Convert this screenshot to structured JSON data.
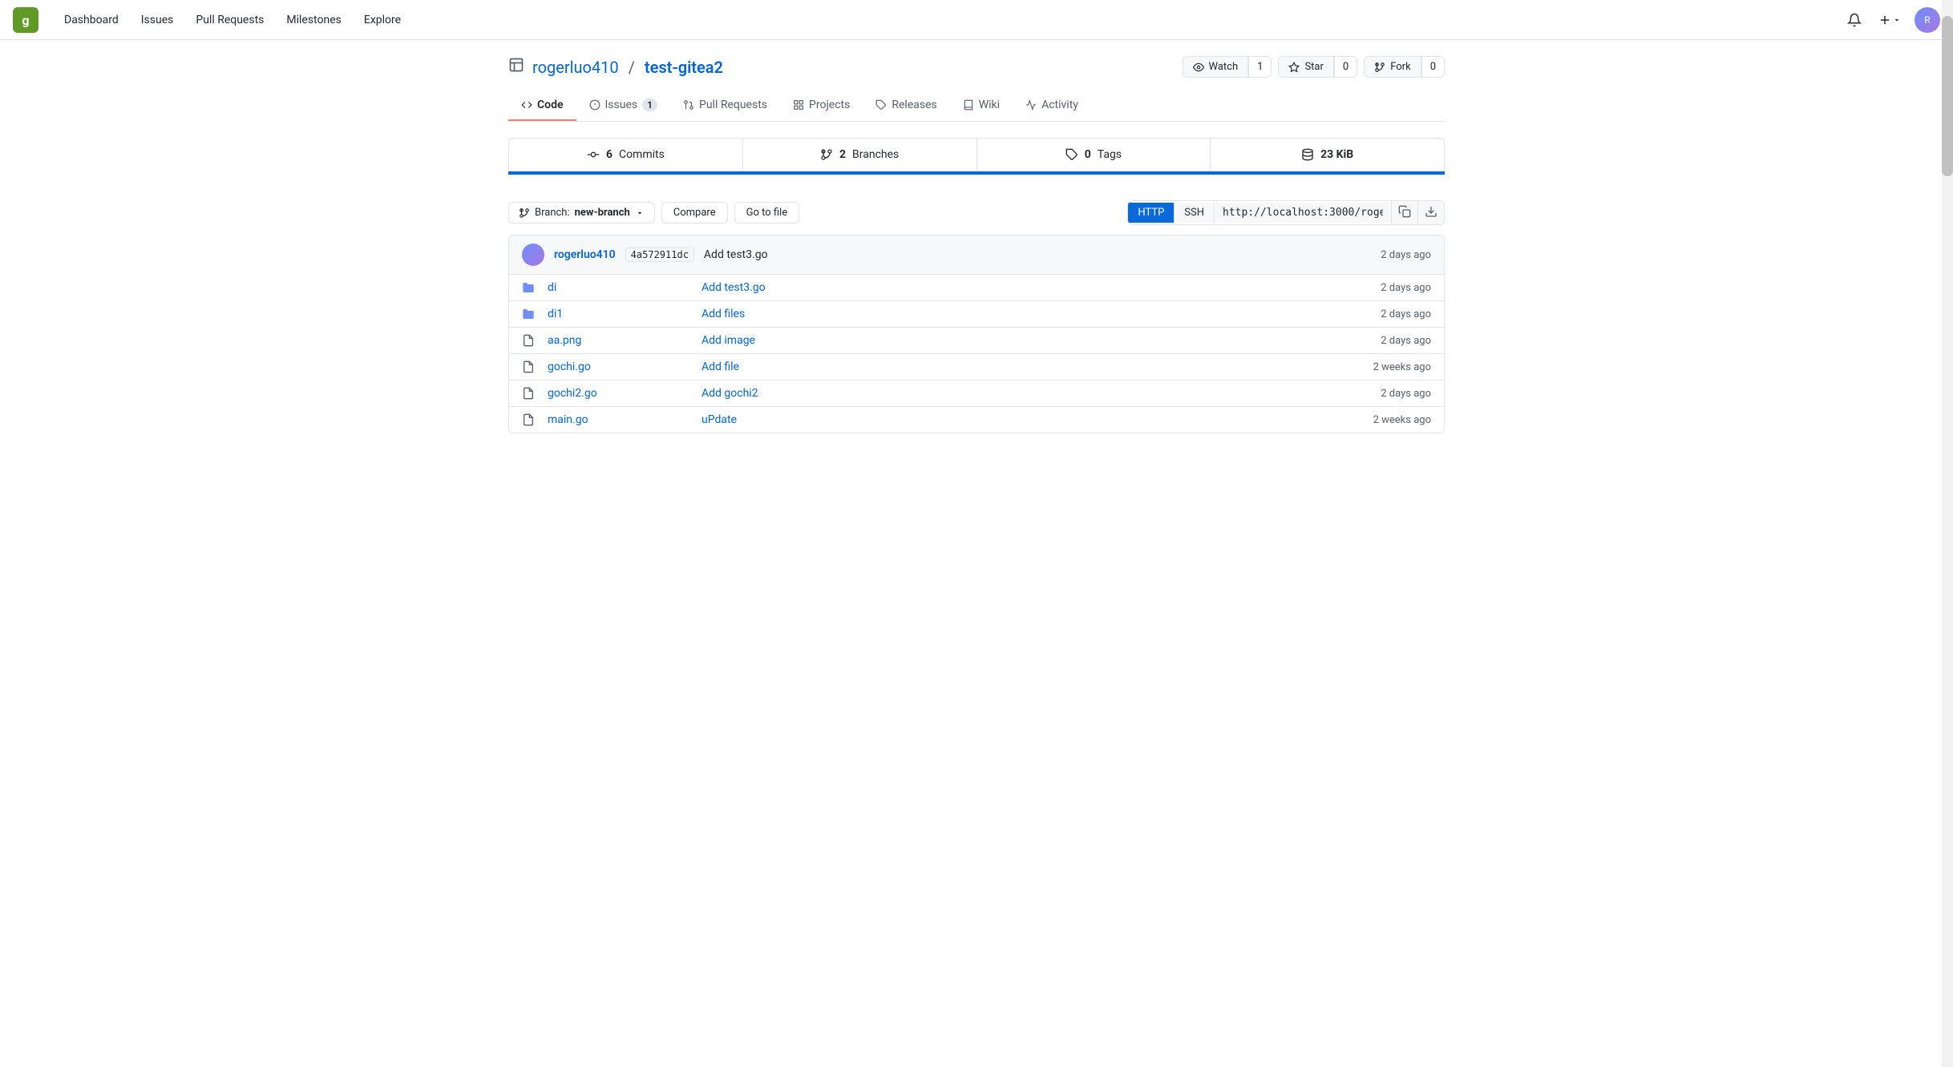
{
  "nav": {
    "links": [
      "Dashboard",
      "Issues",
      "Pull Requests",
      "Milestones",
      "Explore"
    ]
  },
  "repo": {
    "owner": "rogerluo410",
    "name": "test-gitea2",
    "watch_label": "Watch",
    "watch_count": "1",
    "star_label": "Star",
    "star_count": "0",
    "fork_label": "Fork",
    "fork_count": "0"
  },
  "tabs": [
    {
      "label": "Code",
      "active": true,
      "badge": null
    },
    {
      "label": "Issues",
      "active": false,
      "badge": "1"
    },
    {
      "label": "Pull Requests",
      "active": false,
      "badge": null
    },
    {
      "label": "Projects",
      "active": false,
      "badge": null
    },
    {
      "label": "Releases",
      "active": false,
      "badge": null
    },
    {
      "label": "Wiki",
      "active": false,
      "badge": null
    },
    {
      "label": "Activity",
      "active": false,
      "badge": null
    }
  ],
  "stats": {
    "commits": {
      "count": "6",
      "label": "Commits"
    },
    "branches": {
      "count": "2",
      "label": "Branches"
    },
    "tags": {
      "count": "0",
      "label": "Tags"
    },
    "size": {
      "value": "23 KiB"
    }
  },
  "toolbar": {
    "branch_label": "Branch:",
    "branch_name": "new-branch",
    "compare_label": "Compare",
    "goto_label": "Go to file",
    "http_label": "HTTP",
    "ssh_label": "SSH",
    "clone_url": "http://localhost:3000/rogerluo..."
  },
  "commit": {
    "author": "rogerluo410",
    "hash": "4a572911dc",
    "message": "Add test3.go",
    "time": "2 days ago"
  },
  "files": [
    {
      "type": "folder",
      "name": "di",
      "commit": "Add test3.go",
      "time": "2 days ago"
    },
    {
      "type": "folder",
      "name": "di1",
      "commit": "Add files",
      "time": "2 days ago"
    },
    {
      "type": "file",
      "name": "aa.png",
      "commit": "Add image",
      "time": "2 days ago"
    },
    {
      "type": "file",
      "name": "gochi.go",
      "commit": "Add file",
      "time": "2 weeks ago"
    },
    {
      "type": "file",
      "name": "gochi2.go",
      "commit": "Add gochi2",
      "time": "2 days ago"
    },
    {
      "type": "file",
      "name": "main.go",
      "commit": "uPdate",
      "time": "2 weeks ago"
    }
  ]
}
